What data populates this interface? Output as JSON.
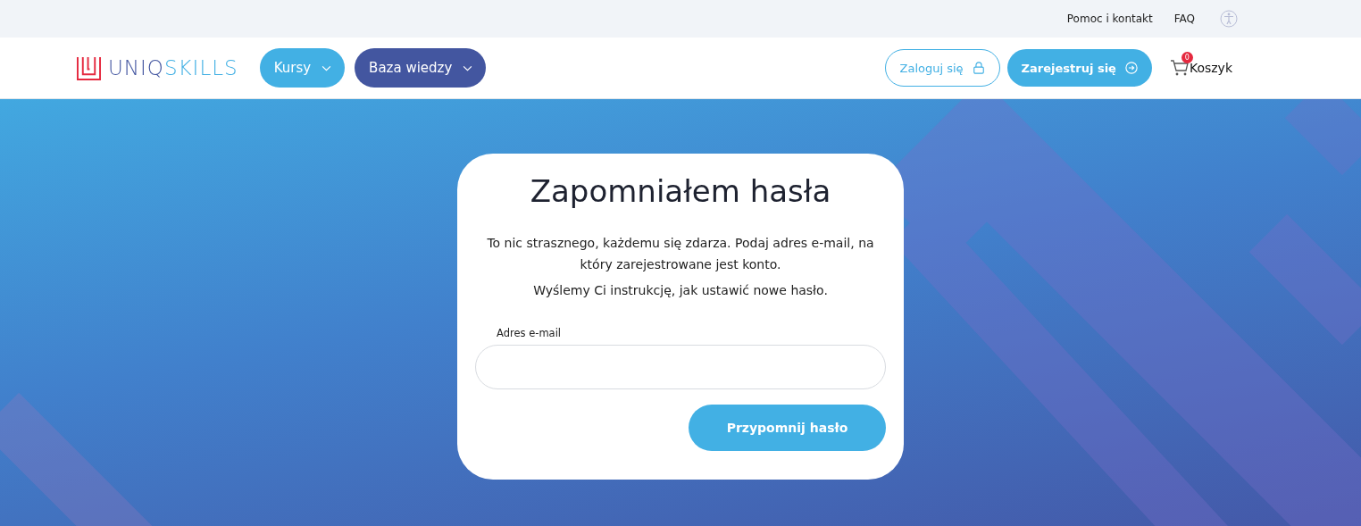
{
  "top_bar": {
    "links": [
      "Pomoc i kontakt",
      "FAQ"
    ]
  },
  "header": {
    "logo": [
      {
        "text": "UNIQ",
        "color": "#4356a0"
      },
      {
        "text": "SKILLS",
        "color": "#42b0e4"
      }
    ],
    "nav": [
      {
        "label": "Kursy",
        "kind": "light"
      },
      {
        "label": "Baza wiedzy",
        "kind": "dark"
      }
    ],
    "login": "Zaloguj się",
    "register": "Zarejestruj się",
    "cart": {
      "label": "Koszyk",
      "count": "0"
    }
  },
  "card": {
    "title": "Zapomniałem hasła",
    "paragraphs": [
      "To nic strasznego, każdemu się zdarza. Podaj adres e-mail, na który zarejestrowane jest konto.",
      "Wyślemy Ci instrukcję, jak ustawić nowe hasło."
    ],
    "field_label": "Adres e-mail",
    "submit": "Przypomnij hasło"
  }
}
